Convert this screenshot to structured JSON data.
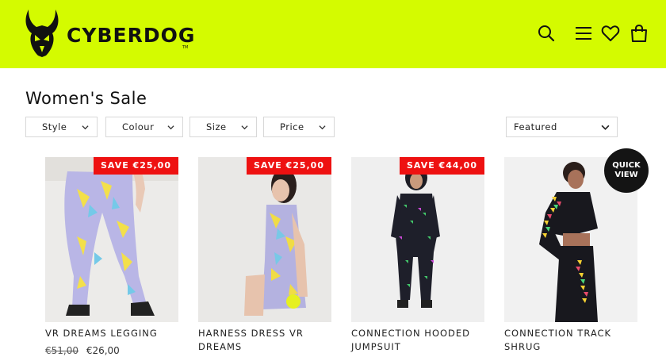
{
  "brand": {
    "name": "CYBERDOG",
    "mark": "TM",
    "header_color": "#d4fb00"
  },
  "header_icons": [
    "search-icon",
    "menu-icon",
    "heart-icon",
    "bag-icon"
  ],
  "page": {
    "title": "Women's Sale"
  },
  "filters": [
    {
      "label": "Style"
    },
    {
      "label": "Colour"
    },
    {
      "label": "Size"
    },
    {
      "label": "Price"
    }
  ],
  "sort": {
    "label": "Featured"
  },
  "quick_view": {
    "line1": "QUICK",
    "line2": "VIEW"
  },
  "products": [
    {
      "name": "VR DREAMS LEGGING",
      "badge": "SAVE €25,00",
      "old_price": "€51,00",
      "price": "€26,00"
    },
    {
      "name": "HARNESS DRESS VR DREAMS",
      "badge": "SAVE €25,00"
    },
    {
      "name": "CONNECTION HOODED JUMPSUIT",
      "badge": "SAVE €44,00"
    },
    {
      "name": "CONNECTION TRACK SHRUG"
    }
  ]
}
